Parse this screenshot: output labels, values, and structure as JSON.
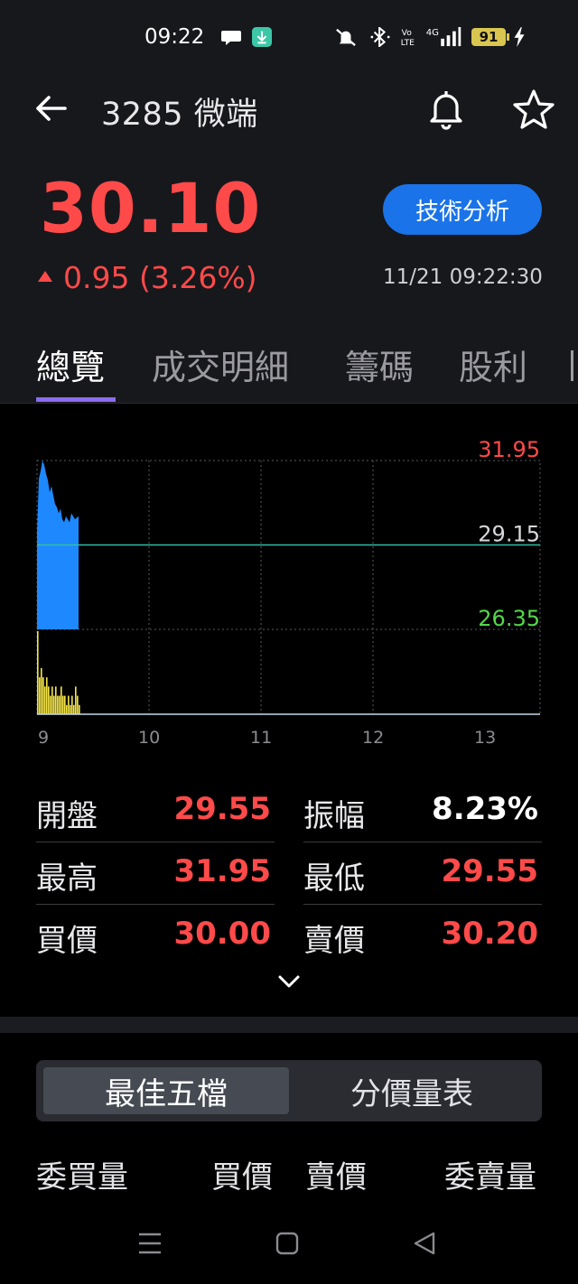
{
  "status_bar": {
    "time": "09:22",
    "battery": "91"
  },
  "header": {
    "title": "3285 微端"
  },
  "quote": {
    "price": "30.10",
    "change": "0.95 (3.26%)",
    "timestamp": "11/21 09:22:30",
    "tech_button": "技術分析"
  },
  "tabs": [
    "總覽",
    "成交明細",
    "籌碼",
    "股利"
  ],
  "colors": {
    "up": "#ff4a4a",
    "down": "#53d849",
    "accent": "#1a73e8",
    "tab_indicator": "#8b6cf0",
    "price_fill": "#1e88ff",
    "volume": "#f5e649",
    "ref_line": "#2fbfa4"
  },
  "chart_data": {
    "type": "area",
    "y_ticks": [
      "31.95",
      "29.15",
      "26.35"
    ],
    "x_ticks": [
      "9",
      "10",
      "11",
      "12",
      "13"
    ],
    "ylim": [
      26.35,
      31.95
    ],
    "reference": 29.15,
    "series": [
      {
        "values": [
          29.55,
          31.35,
          31.6,
          31.95,
          31.8,
          31.5,
          31.3,
          30.9,
          31.1,
          30.8,
          30.5,
          30.4,
          30.2,
          30.35,
          30.0,
          29.9,
          30.1,
          30.0,
          29.9,
          30.2,
          30.1,
          30.0,
          30.05,
          30.1
        ]
      },
      {
        "values": [
          9,
          4,
          5,
          4,
          3,
          4,
          3,
          2,
          3,
          2,
          3,
          2,
          2,
          3,
          2,
          2,
          1,
          2,
          1,
          2,
          1,
          3,
          2,
          1
        ]
      }
    ]
  },
  "stats": [
    {
      "label": "開盤",
      "value": "29.55",
      "color": "#ff4a4a"
    },
    {
      "label": "振幅",
      "value": "8.23%",
      "color": "#ffffff"
    },
    {
      "label": "最高",
      "value": "31.95",
      "color": "#ff4a4a"
    },
    {
      "label": "最低",
      "value": "29.55",
      "color": "#ff4a4a"
    },
    {
      "label": "買價",
      "value": "30.00",
      "color": "#ff4a4a"
    },
    {
      "label": "賣價",
      "value": "30.20",
      "color": "#ff4a4a"
    }
  ],
  "segment": {
    "tabs": [
      "最佳五檔",
      "分價量表"
    ],
    "active": 0
  },
  "orderbook_headers": [
    "委買量",
    "買價",
    "賣價",
    "委賣量"
  ]
}
